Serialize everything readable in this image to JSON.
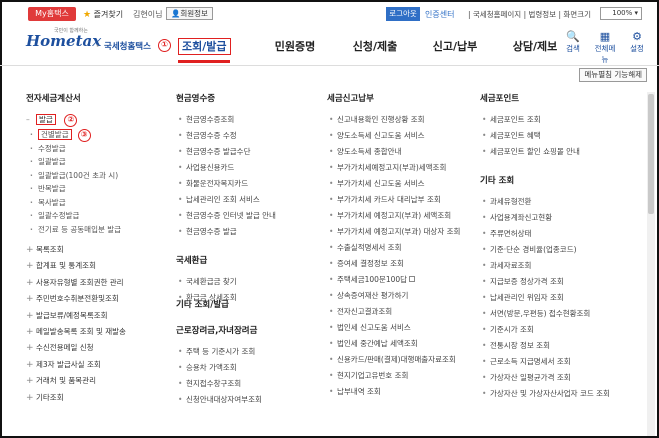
{
  "topbar": {
    "mytax": "My홈택스",
    "favorites": "즐겨찾기",
    "user": "김현이님",
    "userinfo": "회원정보",
    "login": "로그아웃",
    "cert": "인증센터",
    "links": "| 국세청홈페이지 | 법령정보 | 화면크기",
    "zoom": "100%"
  },
  "header": {
    "logo_small": "국민이 함께하는",
    "logo": "Hometax",
    "logo_sub": "국세청홈택스",
    "marker": "①",
    "menu": [
      "조회/발급",
      "민원증명",
      "신청/제출",
      "신고/납부",
      "상담/제보"
    ],
    "icons": [
      {
        "label": "검색",
        "icon": "search-icon",
        "glyph": "🔍"
      },
      {
        "label": "전체메뉴",
        "icon": "grid-icon",
        "glyph": "▦"
      },
      {
        "label": "설정",
        "icon": "gear-icon",
        "glyph": "⚙"
      }
    ]
  },
  "fnbtn": "메뉴펼침 기능해제",
  "col1": {
    "title": "전자세금계산서",
    "issue": "발급",
    "marker2": "②",
    "marker3": "③",
    "subs": [
      "건별발급",
      "수정발급",
      "일괄발급",
      "일괄발급(100건 초과 시)",
      "반복발급",
      "복사발급",
      "일괄수정발급",
      "전기료 등 공동매입분 발급"
    ],
    "groups": [
      "목록조회",
      "합계표 및 통계조회",
      "사용자유형별 조회권한 관리",
      "주민번호수취분전환및조회",
      "발급보류/예정목록조회",
      "메일발송목록 조회 및 재발송",
      "수신전용메일 신청",
      "제3자 발급사실 조회",
      "거래처 및 품목관리",
      "기타조회"
    ]
  },
  "col2": {
    "title": "현금영수증",
    "items": [
      "현금영수증조회",
      "현금영수증 수정",
      "현금영수증 발급수단",
      "사업용신용카드",
      "화물운전자복지카드",
      "납세관리인 조회 서비스",
      "현금영수증 인터넷 발급 안내",
      "현금영수증 발급"
    ],
    "title2": "국세환급",
    "items2": [
      "국세환급금 찾기",
      "환급금 상세조회"
    ],
    "title3": "기타 조회/발급",
    "title4": "근로장려금,자녀장려금",
    "items4": [
      "주택 등 기준시가 조회",
      "승용차 가액조회",
      "현지접수창구조회",
      "신청안내대상자여부조회"
    ]
  },
  "col3": {
    "title": "세금신고납부",
    "items": [
      "신고내용확인 진행상황 조회",
      "양도소득세 신고도움 서비스",
      "양도소득세 종합안내",
      "부가가치세예정고지(부과)세액조회",
      "부가가치세 신고도움 서비스",
      "부가가치세 카드사 대리납부 조회",
      "부가가치세 예정고지(부과) 세액조회",
      "부가가치세 예정고지(부과) 대상자 조회",
      "수출실적명세서 조회",
      "증여세 결정정보 조회",
      "주택세금100문100답",
      "상속증여재산 평가하기",
      "전자신고결과조회",
      "법인세 신고도움 서비스",
      "법인세 중간예납 세액조회",
      "신용카드/판매(결제)대행매출자료조회",
      "현지기업고유번호 조회",
      "납부내역 조회"
    ]
  },
  "col4": {
    "title": "세금포인트",
    "items": [
      "세금포인트 조회",
      "세금포인트 혜택",
      "세금포인트 할인 쇼핑몰 안내"
    ],
    "title2": "기타 조회",
    "items2": [
      "과세유형전환",
      "사업용계좌신고현황",
      "주류면허상태",
      "기준·단순 경비율(업종코드)",
      "과세자료조회",
      "지급보증 정상가격 조회",
      "납세관리인 위임자 조회",
      "서면(방문,우편등) 접수현황조회",
      "기준시가 조회",
      "전통시장 정보 조회",
      "근로소득 지급명세서 조회",
      "가상자산 일평균가격 조회",
      "가상자산 및 가상자산사업자 코드 조회"
    ]
  }
}
